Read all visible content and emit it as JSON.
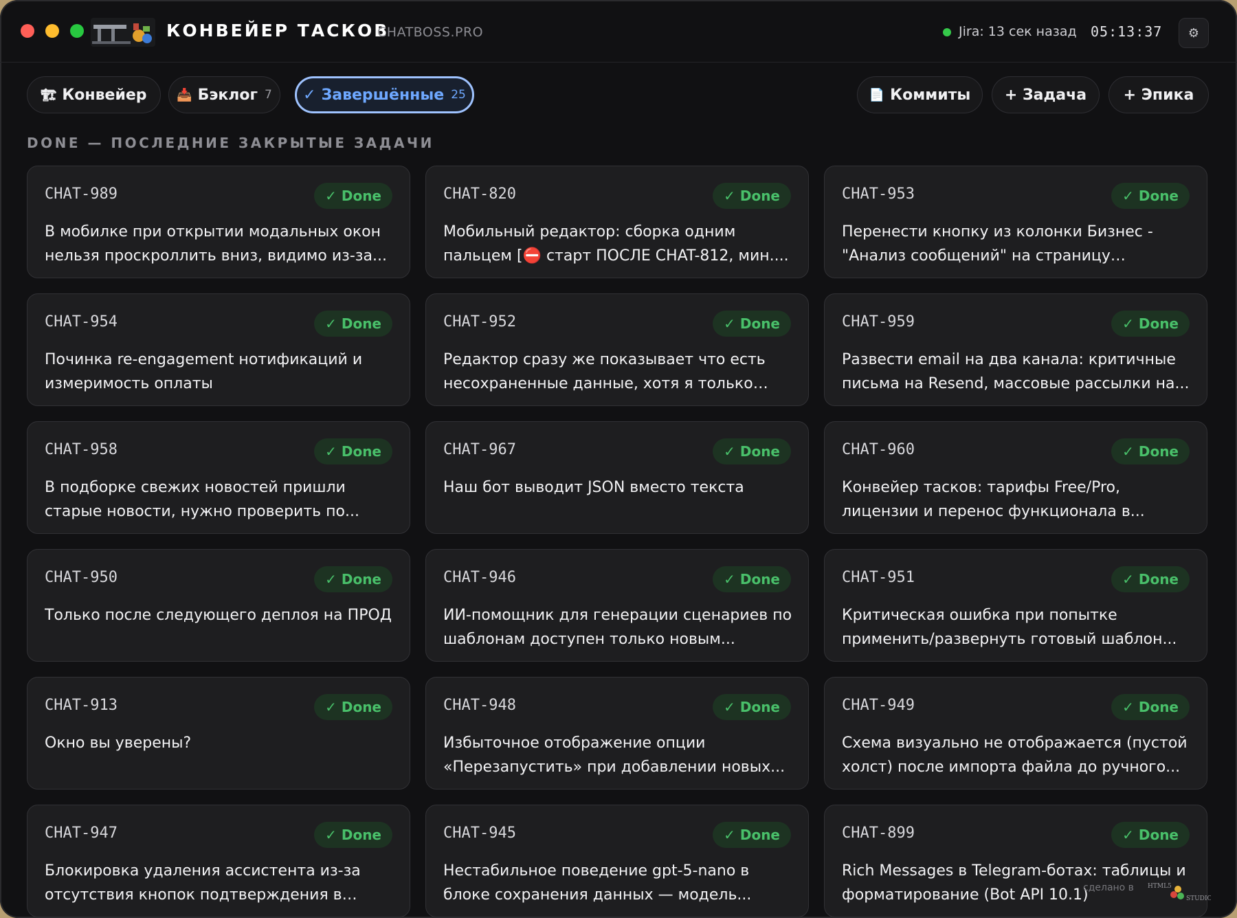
{
  "titlebar": {
    "title": "КОНВЕЙЕР ТАСКОВ",
    "subtitle": "CHATBOSS.PRO",
    "jira_status": "Jira: 13 сек назад",
    "clock": "05:13:37",
    "settings_icon": "⚙"
  },
  "tabs": [
    {
      "icon": "🏗",
      "label": "Конвейер",
      "count": ""
    },
    {
      "icon": "📥",
      "label": "Бэклог",
      "count": "7"
    },
    {
      "icon": "✓",
      "label": "Завершённые",
      "count": "25"
    }
  ],
  "actions": {
    "commits": {
      "icon": "📄",
      "label": "Коммиты"
    },
    "task": "+ Задача",
    "epic": "+ Эпика"
  },
  "section_title": "DONE — ПОСЛЕДНИЕ ЗАКРЫТЫЕ ЗАДАЧИ",
  "cards": [
    {
      "key": "CHAT-989",
      "status": "✓ Done",
      "summary": "В мобилке при открытии модальных окон нельзя проскроллить вниз, видимо из-за..."
    },
    {
      "key": "CHAT-820",
      "status": "✓ Done",
      "summary": "Мобильный редактор: сборка одним пальцем [⛔ старт ПОСЛЕ CHAT-812, мин...."
    },
    {
      "key": "CHAT-953",
      "status": "✓ Done",
      "summary": "Перенести кнопку из колонки Бизнес - \"Анализ сообщений\" на страницу анализа..."
    },
    {
      "key": "CHAT-954",
      "status": "✓ Done",
      "summary": "Починка re-engagement нотификаций и измеримость оплаты"
    },
    {
      "key": "CHAT-952",
      "status": "✓ Done",
      "summary": "Редактор сразу же показывает что есть несохраненные данные, хотя я только его..."
    },
    {
      "key": "CHAT-959",
      "status": "✓ Done",
      "summary": "Развести email на два канала: критичные письма на Resend, массовые рассылки на..."
    },
    {
      "key": "CHAT-958",
      "status": "✓ Done",
      "summary": "В подборке свежих новостей пришли старые новости, нужно проверить по..."
    },
    {
      "key": "CHAT-967",
      "status": "✓ Done",
      "summary": "Наш бот выводит JSON вместо текста"
    },
    {
      "key": "CHAT-960",
      "status": "✓ Done",
      "summary": "Конвейер тасков: тарифы Free/Pro, лицензии и перенос функционала в..."
    },
    {
      "key": "CHAT-950",
      "status": "✓ Done",
      "summary": "Только после следующего деплоя на ПРОД"
    },
    {
      "key": "CHAT-946",
      "status": "✓ Done",
      "summary": "ИИ-помощник для генерации сценариев по шаблонам доступен только новым..."
    },
    {
      "key": "CHAT-951",
      "status": "✓ Done",
      "summary": "Критическая ошибка при попытке применить/развернуть готовый шаблон..."
    },
    {
      "key": "CHAT-913",
      "status": "✓ Done",
      "summary": "Окно вы уверены?"
    },
    {
      "key": "CHAT-948",
      "status": "✓ Done",
      "summary": "Избыточное отображение опции «Перезапустить» при добавлении новых..."
    },
    {
      "key": "CHAT-949",
      "status": "✓ Done",
      "summary": "Схема визуально не отображается (пустой холст) после импорта файла до ручного..."
    },
    {
      "key": "CHAT-947",
      "status": "✓ Done",
      "summary": "Блокировка удаления ассистента из-за отсутствия кнопок подтверждения в окне..."
    },
    {
      "key": "CHAT-945",
      "status": "✓ Done",
      "summary": "Нестабильное поведение gpt-5-nano в блоке сохранения данных — модель..."
    },
    {
      "key": "CHAT-899",
      "status": "✓ Done",
      "summary": "Rich Messages в Telegram-ботах: таблицы и форматирование (Bot API 10.1)"
    }
  ],
  "watermark": {
    "text": "сделано в",
    "logo_text": "HTML5 STUDIO"
  },
  "colors": {
    "accent": "#6ea8ff",
    "done_text": "#49c06a",
    "done_bg": "#1d3322",
    "card_bg": "#1e1e20",
    "window_bg": "#111113"
  }
}
